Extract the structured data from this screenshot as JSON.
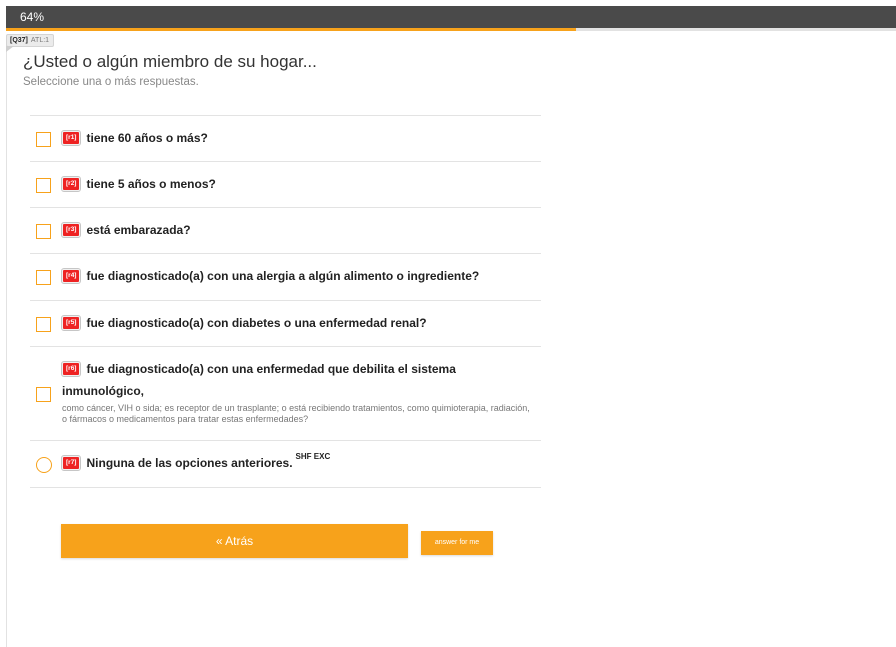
{
  "progress": {
    "label": "64%",
    "fraction": 0.64
  },
  "question_tag": {
    "id": "[Q37]",
    "atl": "ATL:1"
  },
  "question": {
    "title": "¿Usted o algún miembro de su hogar...",
    "instructions": "Seleccione una o más respuestas."
  },
  "options": [
    {
      "code": "[r1]",
      "label": "tiene 60 años o más?",
      "control": "checkbox",
      "checked": false
    },
    {
      "code": "[r2]",
      "label": "tiene 5 años o menos?",
      "control": "checkbox",
      "checked": false
    },
    {
      "code": "[r3]",
      "label": "está embarazada?",
      "control": "checkbox",
      "checked": false
    },
    {
      "code": "[r4]",
      "label": "fue diagnosticado(a) con una alergia a algún alimento o ingrediente?",
      "control": "checkbox",
      "checked": false
    },
    {
      "code": "[r5]",
      "label": "fue diagnosticado(a) con diabetes o una enfermedad renal?",
      "control": "checkbox",
      "checked": false
    },
    {
      "code": "[r6]",
      "label_line1": "fue diagnosticado(a) con una enfermedad que debilita el sistema",
      "label_line2": "inmunológico,",
      "note": "como cáncer, VIH o sida; es receptor de un trasplante; o está recibiendo tratamientos, como quimioterapia, radiación, o fármacos o medicamentos para tratar estas enfermedades?",
      "control": "checkbox",
      "checked": false
    },
    {
      "code": "[r7]",
      "label": "Ninguna de las opciones anteriores.",
      "flags": "SHF EXC",
      "control": "radio",
      "checked": false
    }
  ],
  "buttons": {
    "back": "« Atrás",
    "answer_for_me": "answer for me"
  },
  "colors": {
    "accent": "#f7a21b",
    "topbar": "#4a4a4a",
    "code_badge": "#ee2222"
  }
}
